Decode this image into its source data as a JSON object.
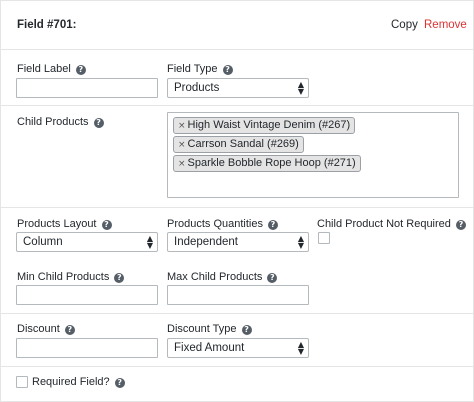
{
  "header": {
    "title": "Field #701:",
    "copy_label": "Copy",
    "remove_label": "Remove"
  },
  "fields": {
    "field_label": {
      "label": "Field Label",
      "value": ""
    },
    "field_type": {
      "label": "Field Type",
      "value": "Products"
    },
    "child_products": {
      "label": "Child Products",
      "selected": [
        "High Waist Vintage Denim (#267)",
        "Carrson Sandal (#269)",
        "Sparkle Bobble Rope Hoop (#271)"
      ],
      "remove_glyph": "×"
    },
    "products_layout": {
      "label": "Products Layout",
      "value": "Column"
    },
    "products_quantities": {
      "label": "Products Quantities",
      "value": "Independent"
    },
    "child_not_required": {
      "label": "Child Product Not Required",
      "checked": false
    },
    "min_child_products": {
      "label": "Min Child Products",
      "value": ""
    },
    "max_child_products": {
      "label": "Max Child Products",
      "value": ""
    },
    "discount": {
      "label": "Discount",
      "value": ""
    },
    "discount_type": {
      "label": "Discount Type",
      "value": "Fixed Amount"
    },
    "required_field": {
      "label": "Required Field?",
      "checked": false
    }
  },
  "icons": {
    "help": "?",
    "select_arrow_up": "▲",
    "select_arrow_down": "▼"
  },
  "colors": {
    "remove_link": "#dc3232",
    "border": "#b4b9be",
    "help_icon_bg": "#555d66"
  }
}
